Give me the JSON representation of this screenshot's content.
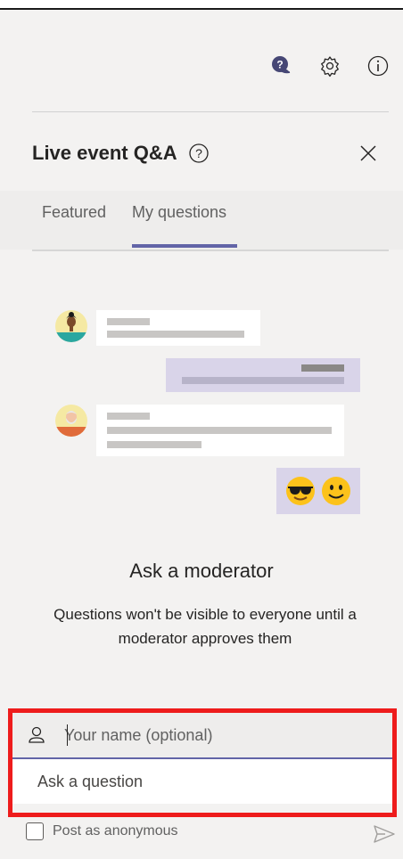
{
  "panel": {
    "title": "Live event Q&A",
    "tabs": [
      {
        "label": "Featured",
        "selected": false
      },
      {
        "label": "My questions",
        "selected": true
      }
    ]
  },
  "toolbar": {
    "icons": [
      "qa-chat-icon",
      "settings-gear-icon",
      "info-icon"
    ]
  },
  "empty_state": {
    "title": "Ask a moderator",
    "description": "Questions won't be visible to everyone until a moderator approves them",
    "emojis": [
      "😎",
      "🙂"
    ]
  },
  "compose": {
    "name_placeholder": "Your name (optional)",
    "question_placeholder": "Ask a question",
    "anonymous_label": "Post as anonymous",
    "anonymous_checked": false
  },
  "colors": {
    "accent": "#6264a7",
    "highlight_border": "#ee1c1c",
    "background": "#f3f2f1",
    "purple_bubble": "#d9d4e9"
  }
}
